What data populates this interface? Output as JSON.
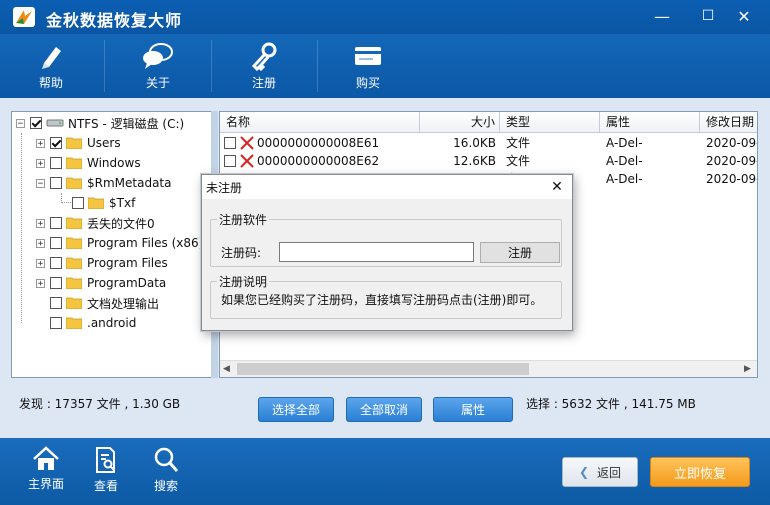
{
  "window": {
    "title": "金秋数据恢复大师",
    "controls": {
      "minimize": "—",
      "maximize": "☐",
      "close": "✕"
    }
  },
  "toolbar": {
    "items": [
      {
        "label": "帮助",
        "icon": "pen-icon"
      },
      {
        "label": "关于",
        "icon": "chat-bubbles-icon"
      },
      {
        "label": "注册",
        "icon": "key-icon"
      },
      {
        "label": "购买",
        "icon": "card-icon"
      }
    ]
  },
  "tree": {
    "root": {
      "label": "NTFS - 逻辑磁盘 (C:)",
      "checked": true
    },
    "items": [
      {
        "label": "Users",
        "checked": true,
        "expandable": true
      },
      {
        "label": "Windows",
        "checked": false,
        "expandable": true
      },
      {
        "label": "$RmMetadata",
        "checked": false,
        "expandable": true,
        "expanded": true
      },
      {
        "label": "$Txf",
        "checked": false,
        "expandable": false,
        "child": true
      },
      {
        "label": "丢失的文件0",
        "checked": false,
        "expandable": true
      },
      {
        "label": "Program Files (x86)",
        "checked": false,
        "expandable": true
      },
      {
        "label": "Program Files",
        "checked": false,
        "expandable": true
      },
      {
        "label": "ProgramData",
        "checked": false,
        "expandable": true
      },
      {
        "label": "文档处理输出",
        "checked": false,
        "expandable": false
      },
      {
        "label": ".android",
        "checked": false,
        "expandable": false
      }
    ]
  },
  "list": {
    "columns": [
      "名称",
      "大小",
      "类型",
      "属性",
      "修改日期"
    ],
    "rows": [
      {
        "name": "0000000000008E61",
        "size": "16.0KB",
        "type": "文件",
        "attr": "A-Del-",
        "date": "2020-09-"
      },
      {
        "name": "0000000000008E62",
        "size": "12.6KB",
        "type": "文件",
        "attr": "A-Del-",
        "date": "2020-09-"
      },
      {
        "name": "",
        "size": "",
        "type": "文件",
        "attr": "A-Del-",
        "date": "2020-09-"
      }
    ]
  },
  "status": {
    "found": "发现 : 17357 文件 , 1.30 GB",
    "selected": "选择 : 5632 文件 , 141.75 MB"
  },
  "actions": {
    "select_all": "选择全部",
    "deselect_all": "全部取消",
    "properties": "属性"
  },
  "bottom_nav": {
    "items": [
      {
        "label": "主界面",
        "icon": "home-icon"
      },
      {
        "label": "查看",
        "icon": "document-view-icon"
      },
      {
        "label": "搜索",
        "icon": "search-icon"
      }
    ],
    "back": "返回",
    "recover": "立即恢复"
  },
  "dialog": {
    "title": "未注册",
    "close": "✕",
    "register_group": "注册软件",
    "code_label": "注册码:",
    "code_value": "",
    "register_button": "注册",
    "info_group": "注册说明",
    "info_text": "如果您已经购买了注册码，直接填写注册码点击(注册)即可。"
  },
  "colors": {
    "titlebar": "#0a56a3",
    "main_bg": "#dde7f3",
    "accent_button": "#2a7fd3",
    "recover_button": "#f39a1c"
  }
}
